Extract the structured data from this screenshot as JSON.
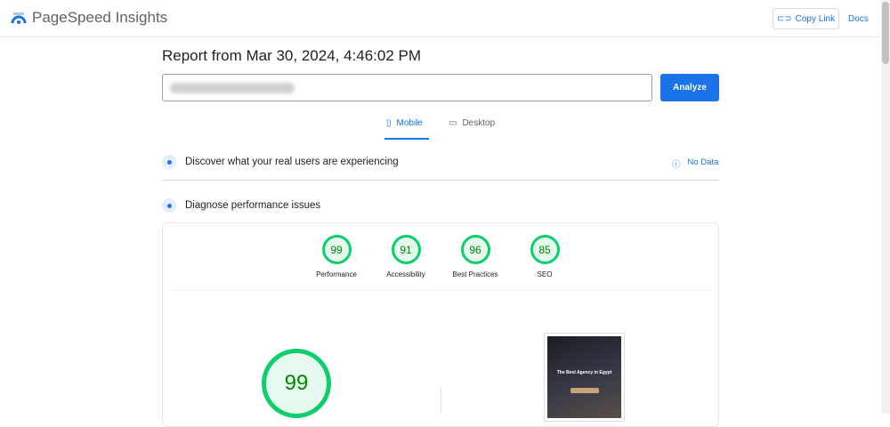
{
  "header": {
    "app_title": "PageSpeed Insights",
    "copy_link": "Copy Link",
    "docs": "Docs"
  },
  "report": {
    "title": "Report from Mar 30, 2024, 4:46:02 PM",
    "analyze": "Analyze"
  },
  "tabs": [
    {
      "label": "Mobile"
    },
    {
      "label": "Desktop"
    }
  ],
  "sections": {
    "real_users": "Discover what your real users are experiencing",
    "no_data": "No Data",
    "diagnose": "Diagnose performance issues"
  },
  "scores": [
    {
      "label": "Performance",
      "value": "99"
    },
    {
      "label": "Accessibility",
      "value": "91"
    },
    {
      "label": "Best Practices",
      "value": "96"
    },
    {
      "label": "SEO",
      "value": "85"
    }
  ],
  "main_score": "99",
  "screenshot": {
    "headline": "The Best Agency in Egypt"
  }
}
